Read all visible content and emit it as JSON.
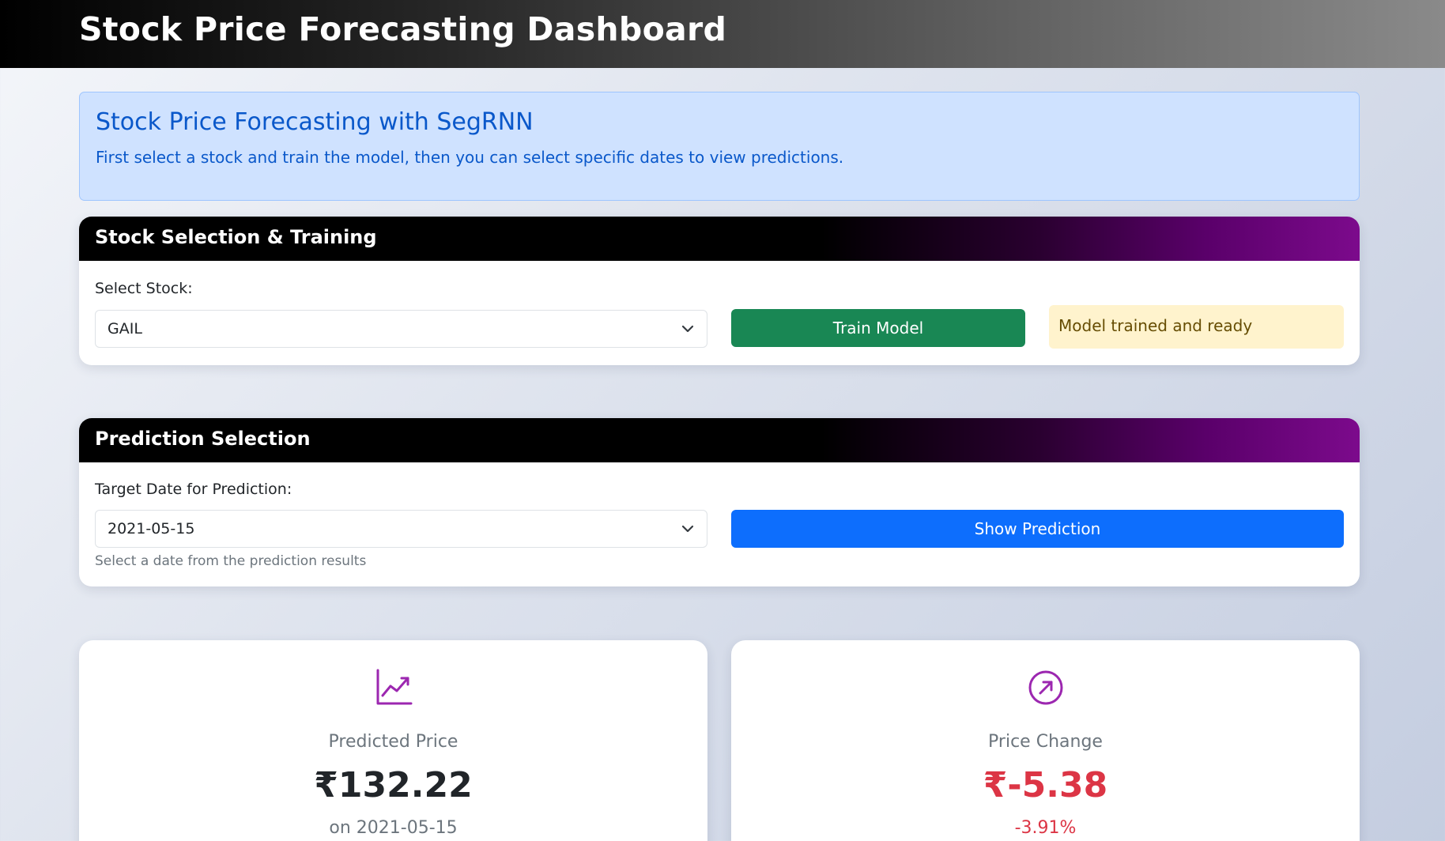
{
  "header": {
    "title": "Stock Price Forecasting Dashboard"
  },
  "info": {
    "title": "Stock Price Forecasting with SegRNN",
    "text": "First select a stock and train the model, then you can select specific dates to view predictions."
  },
  "stock_section": {
    "title": "Stock Selection & Training",
    "select_label": "Select Stock:",
    "selected_stock": "GAIL",
    "train_button": "Train Model",
    "status": "Model trained and ready"
  },
  "prediction_section": {
    "title": "Prediction Selection",
    "date_label": "Target Date for Prediction:",
    "selected_date": "2021-05-15",
    "help_text": "Select a date from the prediction results",
    "show_button": "Show Prediction"
  },
  "stats": {
    "predicted": {
      "icon": "chart-line-icon",
      "label": "Predicted Price",
      "value": "₹132.22",
      "sub": "on 2021-05-15"
    },
    "change": {
      "icon": "arrow-up-right-circle-icon",
      "label": "Price Change",
      "value": "₹-5.38",
      "sub": "-3.91%"
    }
  },
  "colors": {
    "accent_purple": "#9c27b0",
    "negative": "#dc3545",
    "train_button": "#198754",
    "show_button": "#0d6efd"
  }
}
